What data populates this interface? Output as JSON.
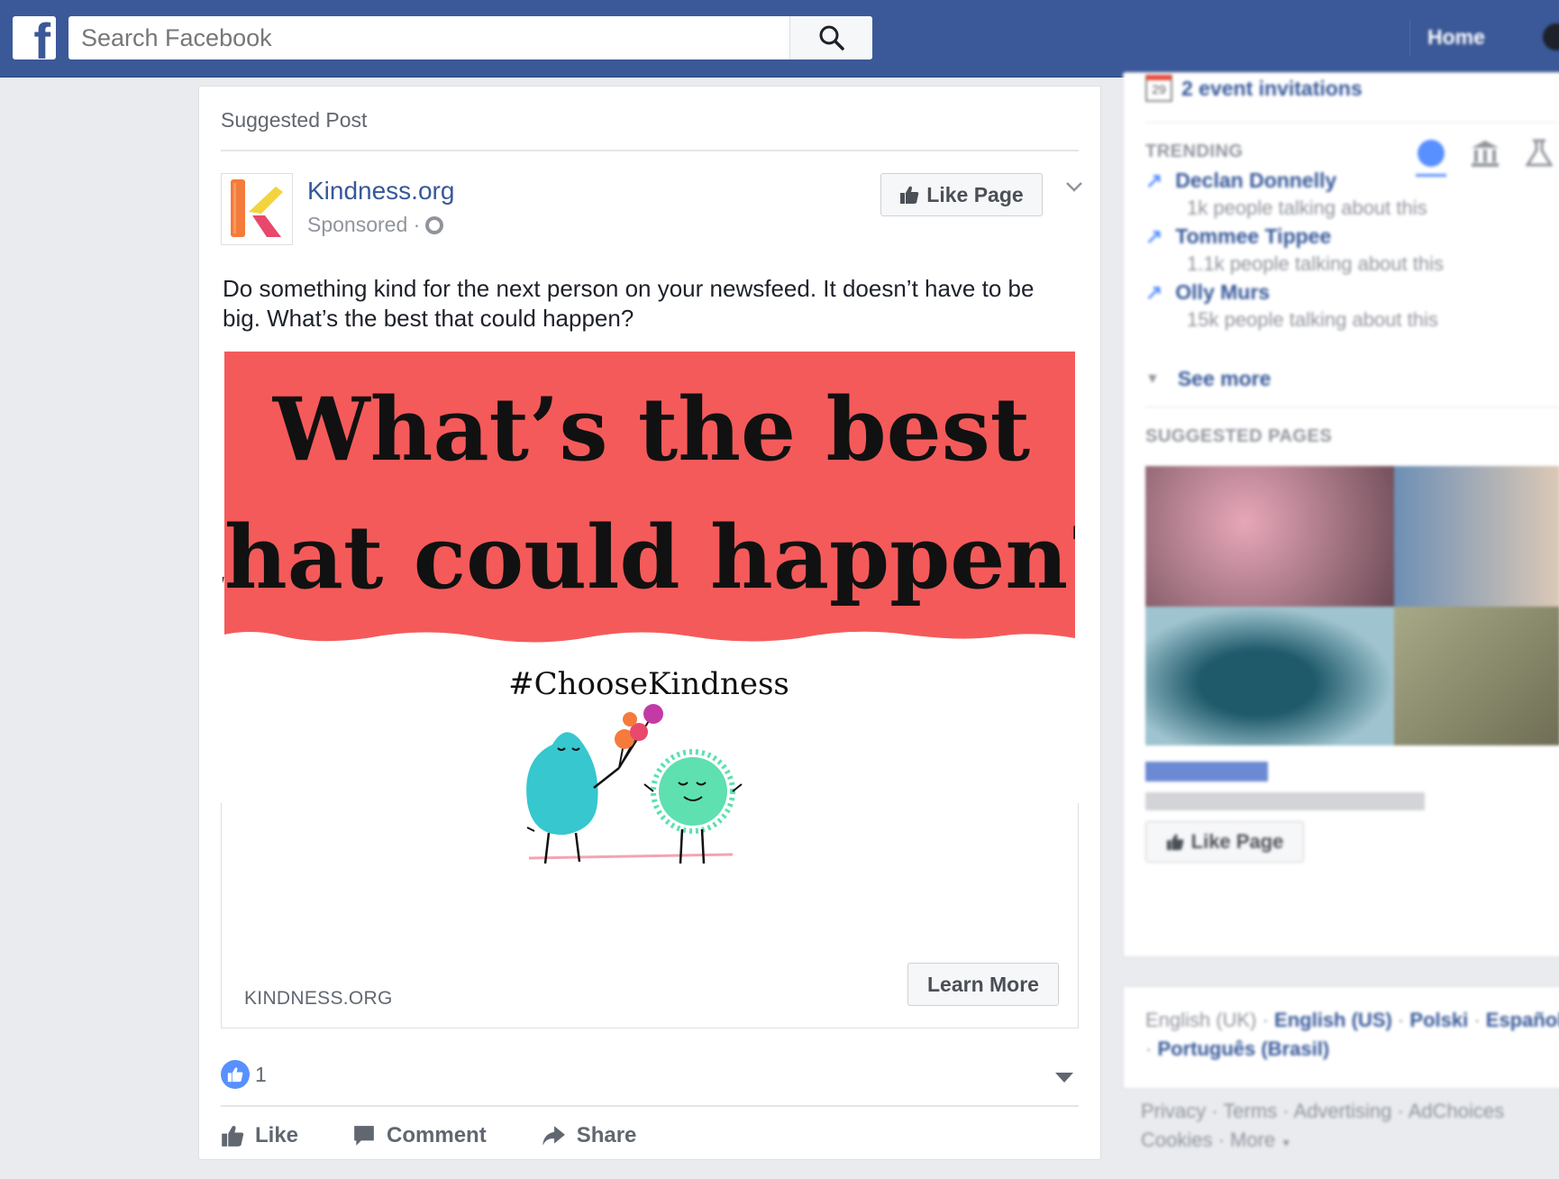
{
  "topbar": {
    "search_placeholder": "Search Facebook",
    "nav_home": "Home"
  },
  "post": {
    "header_label": "Suggested Post",
    "page_name": "Kindness.org",
    "sponsored": "Sponsored ·",
    "like_page_label": "Like Page",
    "text": "Do something kind for the next person on your newsfeed. It doesn’t have to be big. What’s the best that could happen?",
    "creative": {
      "headline_line1": "What’s the best",
      "headline_line2": "that could happen?",
      "hashtag": "#ChooseKindness",
      "banner_color": "#f55a5a"
    },
    "link_domain": "KINDNESS.ORG",
    "cta_label": "Learn More",
    "reaction_count": "1",
    "actions": {
      "like": "Like",
      "comment": "Comment",
      "share": "Share"
    }
  },
  "sidebar": {
    "events_date": "29",
    "events_label": "2 event invitations",
    "trending_title": "TRENDING",
    "trending": [
      {
        "name": "Declan Donnelly",
        "sub": "1k people talking about this"
      },
      {
        "name": "Tommee Tippee",
        "sub": "1.1k people talking about this"
      },
      {
        "name": "Olly Murs",
        "sub": "15k people talking about this"
      }
    ],
    "see_more": "See more",
    "suggested_pages_title": "SUGGESTED PAGES",
    "suggested_like_label": "Like Page",
    "languages": {
      "current": "English (UK) ·",
      "links": [
        "English (US)",
        "Polski",
        "Español",
        "Português (Brasil)"
      ]
    },
    "footer": {
      "privacy": "Privacy",
      "terms": "Terms",
      "advertising": "Advertising",
      "adchoices": "AdChoices",
      "cookies": "Cookies",
      "more": "More"
    }
  },
  "colors": {
    "brand": "#3b5998",
    "link": "#365899",
    "reaction_blue": "#5890ff"
  }
}
